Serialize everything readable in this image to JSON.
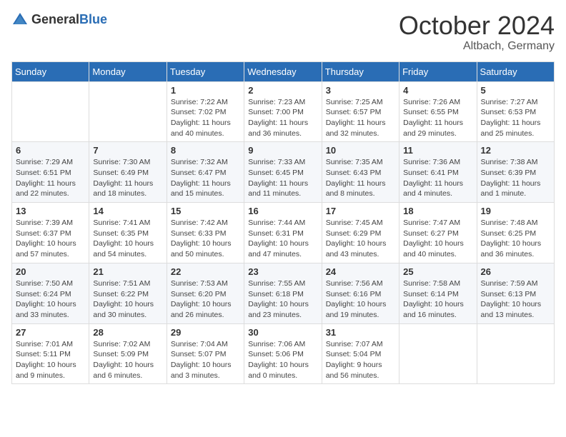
{
  "header": {
    "logo_general": "General",
    "logo_blue": "Blue",
    "month_title": "October 2024",
    "location": "Altbach, Germany"
  },
  "days_of_week": [
    "Sunday",
    "Monday",
    "Tuesday",
    "Wednesday",
    "Thursday",
    "Friday",
    "Saturday"
  ],
  "weeks": [
    [
      {
        "day": "",
        "info": ""
      },
      {
        "day": "",
        "info": ""
      },
      {
        "day": "1",
        "info": "Sunrise: 7:22 AM\nSunset: 7:02 PM\nDaylight: 11 hours and 40 minutes."
      },
      {
        "day": "2",
        "info": "Sunrise: 7:23 AM\nSunset: 7:00 PM\nDaylight: 11 hours and 36 minutes."
      },
      {
        "day": "3",
        "info": "Sunrise: 7:25 AM\nSunset: 6:57 PM\nDaylight: 11 hours and 32 minutes."
      },
      {
        "day": "4",
        "info": "Sunrise: 7:26 AM\nSunset: 6:55 PM\nDaylight: 11 hours and 29 minutes."
      },
      {
        "day": "5",
        "info": "Sunrise: 7:27 AM\nSunset: 6:53 PM\nDaylight: 11 hours and 25 minutes."
      }
    ],
    [
      {
        "day": "6",
        "info": "Sunrise: 7:29 AM\nSunset: 6:51 PM\nDaylight: 11 hours and 22 minutes."
      },
      {
        "day": "7",
        "info": "Sunrise: 7:30 AM\nSunset: 6:49 PM\nDaylight: 11 hours and 18 minutes."
      },
      {
        "day": "8",
        "info": "Sunrise: 7:32 AM\nSunset: 6:47 PM\nDaylight: 11 hours and 15 minutes."
      },
      {
        "day": "9",
        "info": "Sunrise: 7:33 AM\nSunset: 6:45 PM\nDaylight: 11 hours and 11 minutes."
      },
      {
        "day": "10",
        "info": "Sunrise: 7:35 AM\nSunset: 6:43 PM\nDaylight: 11 hours and 8 minutes."
      },
      {
        "day": "11",
        "info": "Sunrise: 7:36 AM\nSunset: 6:41 PM\nDaylight: 11 hours and 4 minutes."
      },
      {
        "day": "12",
        "info": "Sunrise: 7:38 AM\nSunset: 6:39 PM\nDaylight: 11 hours and 1 minute."
      }
    ],
    [
      {
        "day": "13",
        "info": "Sunrise: 7:39 AM\nSunset: 6:37 PM\nDaylight: 10 hours and 57 minutes."
      },
      {
        "day": "14",
        "info": "Sunrise: 7:41 AM\nSunset: 6:35 PM\nDaylight: 10 hours and 54 minutes."
      },
      {
        "day": "15",
        "info": "Sunrise: 7:42 AM\nSunset: 6:33 PM\nDaylight: 10 hours and 50 minutes."
      },
      {
        "day": "16",
        "info": "Sunrise: 7:44 AM\nSunset: 6:31 PM\nDaylight: 10 hours and 47 minutes."
      },
      {
        "day": "17",
        "info": "Sunrise: 7:45 AM\nSunset: 6:29 PM\nDaylight: 10 hours and 43 minutes."
      },
      {
        "day": "18",
        "info": "Sunrise: 7:47 AM\nSunset: 6:27 PM\nDaylight: 10 hours and 40 minutes."
      },
      {
        "day": "19",
        "info": "Sunrise: 7:48 AM\nSunset: 6:25 PM\nDaylight: 10 hours and 36 minutes."
      }
    ],
    [
      {
        "day": "20",
        "info": "Sunrise: 7:50 AM\nSunset: 6:24 PM\nDaylight: 10 hours and 33 minutes."
      },
      {
        "day": "21",
        "info": "Sunrise: 7:51 AM\nSunset: 6:22 PM\nDaylight: 10 hours and 30 minutes."
      },
      {
        "day": "22",
        "info": "Sunrise: 7:53 AM\nSunset: 6:20 PM\nDaylight: 10 hours and 26 minutes."
      },
      {
        "day": "23",
        "info": "Sunrise: 7:55 AM\nSunset: 6:18 PM\nDaylight: 10 hours and 23 minutes."
      },
      {
        "day": "24",
        "info": "Sunrise: 7:56 AM\nSunset: 6:16 PM\nDaylight: 10 hours and 19 minutes."
      },
      {
        "day": "25",
        "info": "Sunrise: 7:58 AM\nSunset: 6:14 PM\nDaylight: 10 hours and 16 minutes."
      },
      {
        "day": "26",
        "info": "Sunrise: 7:59 AM\nSunset: 6:13 PM\nDaylight: 10 hours and 13 minutes."
      }
    ],
    [
      {
        "day": "27",
        "info": "Sunrise: 7:01 AM\nSunset: 5:11 PM\nDaylight: 10 hours and 9 minutes."
      },
      {
        "day": "28",
        "info": "Sunrise: 7:02 AM\nSunset: 5:09 PM\nDaylight: 10 hours and 6 minutes."
      },
      {
        "day": "29",
        "info": "Sunrise: 7:04 AM\nSunset: 5:07 PM\nDaylight: 10 hours and 3 minutes."
      },
      {
        "day": "30",
        "info": "Sunrise: 7:06 AM\nSunset: 5:06 PM\nDaylight: 10 hours and 0 minutes."
      },
      {
        "day": "31",
        "info": "Sunrise: 7:07 AM\nSunset: 5:04 PM\nDaylight: 9 hours and 56 minutes."
      },
      {
        "day": "",
        "info": ""
      },
      {
        "day": "",
        "info": ""
      }
    ]
  ]
}
